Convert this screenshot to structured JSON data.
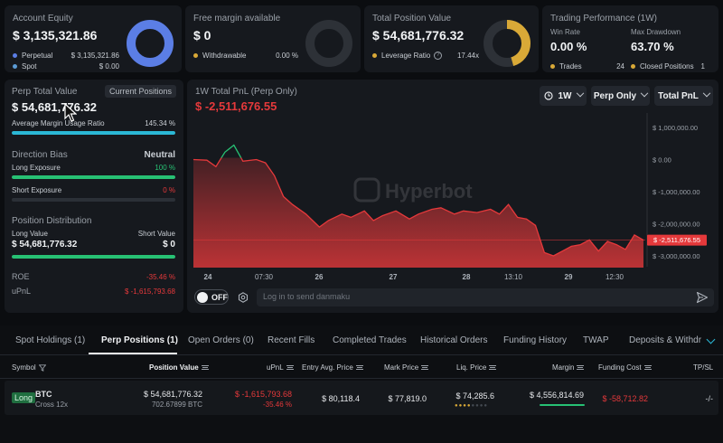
{
  "summary": {
    "equity": {
      "label": "Account Equity",
      "value": "$ 3,135,321.86",
      "items": [
        {
          "label": "Perpetual",
          "value": "$ 3,135,321.86",
          "color": "#5b7ee5"
        },
        {
          "label": "Spot",
          "value": "$ 0.00",
          "color": "#5b9bd5"
        }
      ]
    },
    "free_margin": {
      "label": "Free margin available",
      "value": "$ 0",
      "items": [
        {
          "label": "Withdrawable",
          "value": "0.00 %",
          "color": "#d9a937"
        }
      ]
    },
    "position": {
      "label": "Total Position Value",
      "value": "$ 54,681,776.32",
      "items": [
        {
          "label": "Leverage Ratio",
          "value": "17.44x",
          "color": "#d9a937"
        }
      ]
    },
    "performance": {
      "label": "Trading Performance (1W)",
      "win_rate_label": "Win Rate",
      "win_rate": "0.00 %",
      "drawdown_label": "Max Drawdown",
      "drawdown": "63.70 %",
      "trades_label": "Trades",
      "trades": "24",
      "closed_label": "Closed Positions",
      "closed": "1"
    }
  },
  "perp": {
    "title": "Perp Total Value",
    "badge": "Current Positions",
    "value": "$ 54,681,776.32",
    "margin_label": "Average Margin Usage Ratio",
    "margin_value": "145.34 %",
    "margin_fill": 1.0,
    "bias_label": "Direction Bias",
    "bias_value": "Neutral",
    "long_label": "Long Exposure",
    "long_value": "100 %",
    "long_fill": 1.0,
    "short_label": "Short Exposure",
    "short_value": "0 %",
    "short_fill": 0.0,
    "dist_title": "Position Distribution",
    "long_value_label": "Long Value",
    "short_value_label": "Short Value",
    "long_amount": "$ 54,681,776.32",
    "short_amount": "$ 0",
    "dist_fill": 1.0,
    "roe_label": "ROE",
    "roe_value": "-35.46 %",
    "upnl_label": "uPnL",
    "upnl_value": "$ -1,615,793.68"
  },
  "pnl": {
    "title": "1W Total PnL (Perp Only)",
    "value": "$ -2,511,676.55",
    "period": "1W",
    "scope": "Perp Only",
    "metric": "Total PnL",
    "watermark": "Hyperbot",
    "toggle_label": "OFF",
    "chat_placeholder": "Log in to send danmaku",
    "current_label": "$ -2,511,676.55"
  },
  "chart_data": {
    "type": "area",
    "x_ticks": [
      "24",
      "07:30",
      "26",
      "27",
      "28",
      "13:10",
      "29",
      "12:30"
    ],
    "y_ticks": [
      "$ 1,000,000.00",
      "$ 0.00",
      "$ -1,000,000.00",
      "$ -2,000,000.00",
      "$ -3,000,000.00"
    ],
    "ylim": [
      -3300000,
      1300000
    ],
    "x": [
      0,
      3,
      5,
      7,
      9,
      11,
      14,
      16,
      18,
      20,
      22,
      25,
      28,
      30,
      33,
      35,
      38,
      40,
      42,
      45,
      48,
      50,
      53,
      55,
      58,
      60,
      63,
      66,
      68,
      70,
      72,
      74,
      76,
      78,
      80,
      82,
      84,
      86,
      88,
      90,
      92,
      94,
      96,
      98,
      100
    ],
    "y": [
      0,
      -20000,
      -220000,
      230000,
      450000,
      -50000,
      0,
      -100000,
      -500000,
      -1150000,
      -1400000,
      -1700000,
      -2100000,
      -1900000,
      -1700000,
      -1800000,
      -1600000,
      -1900000,
      -1750000,
      -1600000,
      -1850000,
      -1700000,
      -1550000,
      -1500000,
      -1700000,
      -1600000,
      -1650000,
      -1550000,
      -1700000,
      -1400000,
      -1800000,
      -1850000,
      -2050000,
      -2900000,
      -3000000,
      -2850000,
      -2700000,
      -2650000,
      -2500000,
      -2850000,
      -2550000,
      -2650000,
      -2800000,
      -2350000,
      -2510000
    ],
    "positive_color": "#27c174",
    "negative_color": "#e5393b",
    "grid": false
  },
  "tabs": [
    {
      "label": "Spot Holdings (1)"
    },
    {
      "label": "Perp Positions (1)",
      "active": true
    },
    {
      "label": "Open Orders (0)"
    },
    {
      "label": "Recent Fills"
    },
    {
      "label": "Completed Trades"
    },
    {
      "label": "Historical Orders"
    },
    {
      "label": "Funding History"
    },
    {
      "label": "TWAP"
    },
    {
      "label": "Deposits & Withdraw"
    }
  ],
  "table": {
    "headers": {
      "symbol": "Symbol",
      "position": "Position Value",
      "upnl": "uPnL",
      "entry": "Entry Avg. Price",
      "mark": "Mark Price",
      "liq": "Liq. Price",
      "margin": "Margin",
      "funding": "Funding Cost",
      "tpsl": "TP/SL"
    },
    "row": {
      "side": "Long",
      "coin": "BTC",
      "mode": "Cross 12x",
      "position": "$ 54,681,776.32",
      "size": "702.67899 BTC",
      "upnl": "$ -1,615,793.68",
      "upnl_pct": "-35.46 %",
      "entry": "$ 80,118.4",
      "mark": "$ 77,819.0",
      "liq": "$ 74,285.6",
      "margin": "$ 4,556,814.69",
      "funding": "$ -58,712.82",
      "tpsl": "-/-"
    }
  },
  "colors": {
    "accent_blue": "#5b7ee5",
    "gold": "#d9a937",
    "cyan": "#2bb8d6",
    "green": "#27c174",
    "red": "#e5393b"
  }
}
